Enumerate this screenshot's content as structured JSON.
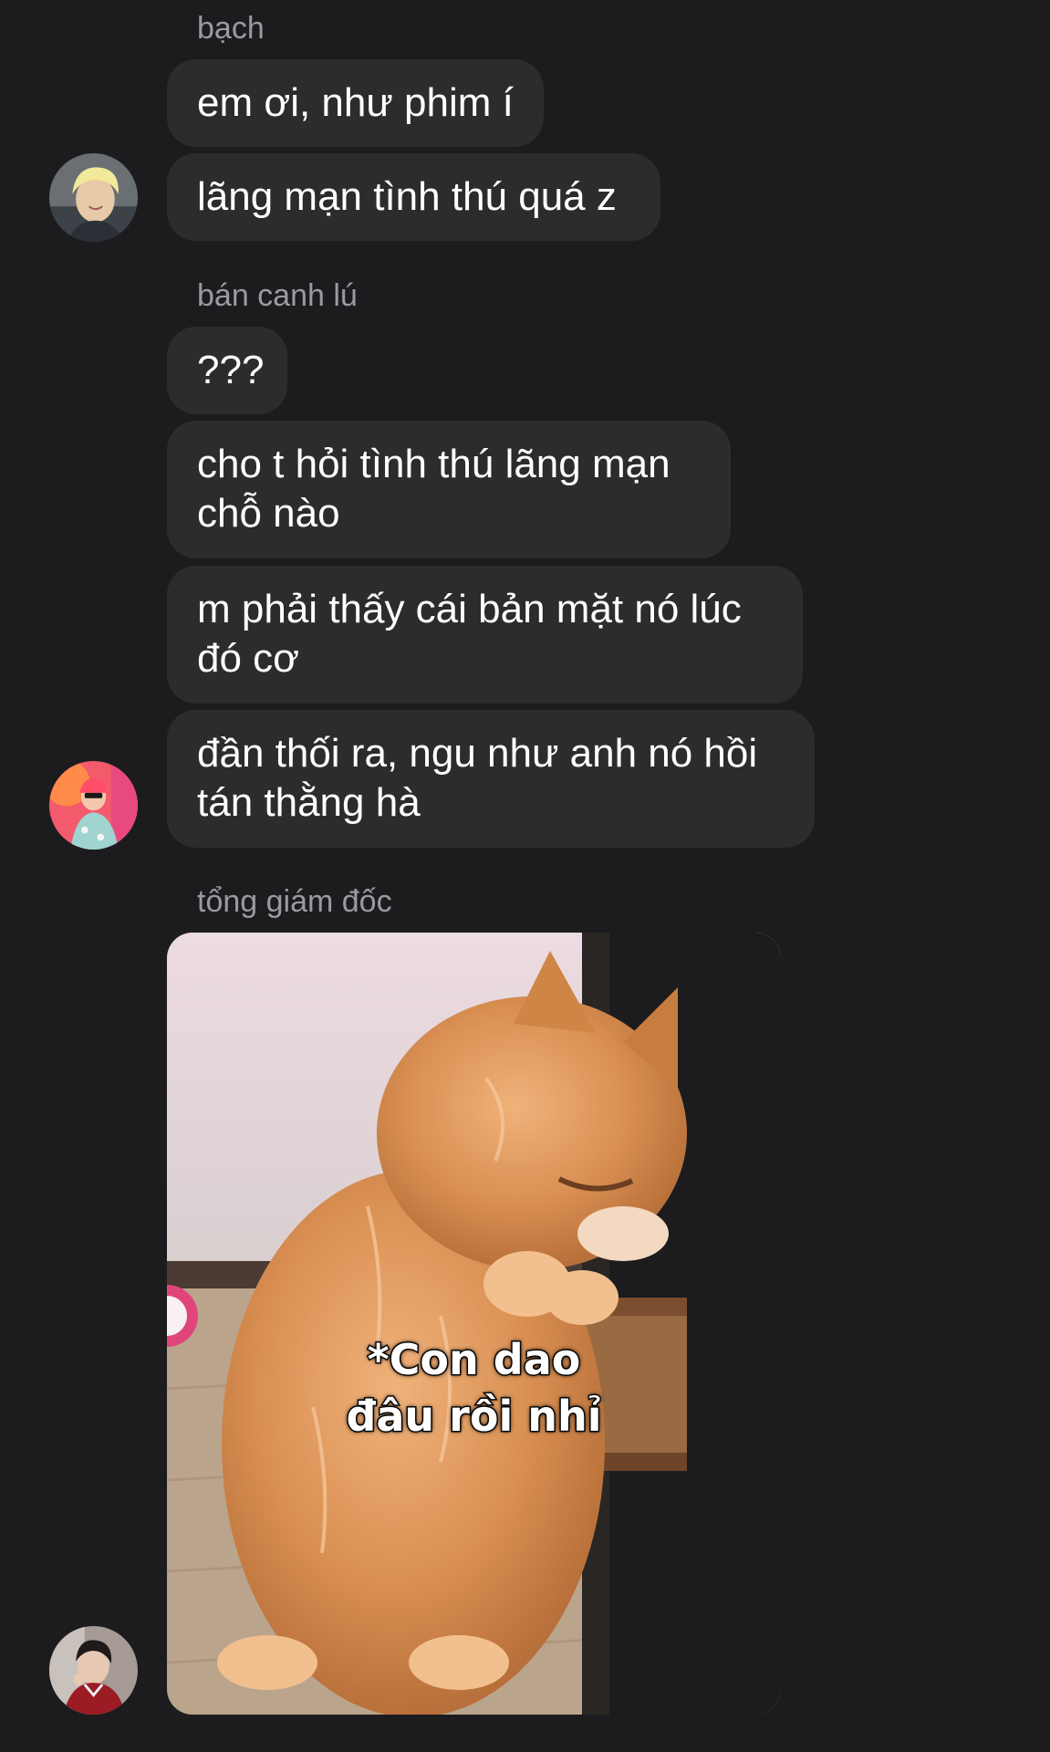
{
  "groups": [
    {
      "sender": "bạch",
      "messages": [
        "em ơi, như phim í",
        "lãng mạn tình thú quá z"
      ],
      "avatar_icon": "avatar-blonde-person"
    },
    {
      "sender": "bán canh lú",
      "messages": [
        "???",
        "cho t hỏi tình thú lãng mạn\nchỗ nào",
        "m phải thấy cái bản mặt nó lúc\nđó cơ",
        "đần thối ra, ngu như anh nó hồi\ntán thằng hà"
      ],
      "avatar_icon": "avatar-pink-person"
    },
    {
      "sender": "tổng giám đốc",
      "image": {
        "subject": "orange cat peeking into a drawer",
        "caption_line1": "*Con dao",
        "caption_line2": "đâu rồi nhỉ"
      },
      "avatar_icon": "avatar-dark-haired-person"
    }
  ],
  "colors": {
    "background": "#1c1c1e",
    "bubble": "#2c2c2e",
    "sender_name": "#9a9a9f",
    "text": "#ffffff"
  }
}
